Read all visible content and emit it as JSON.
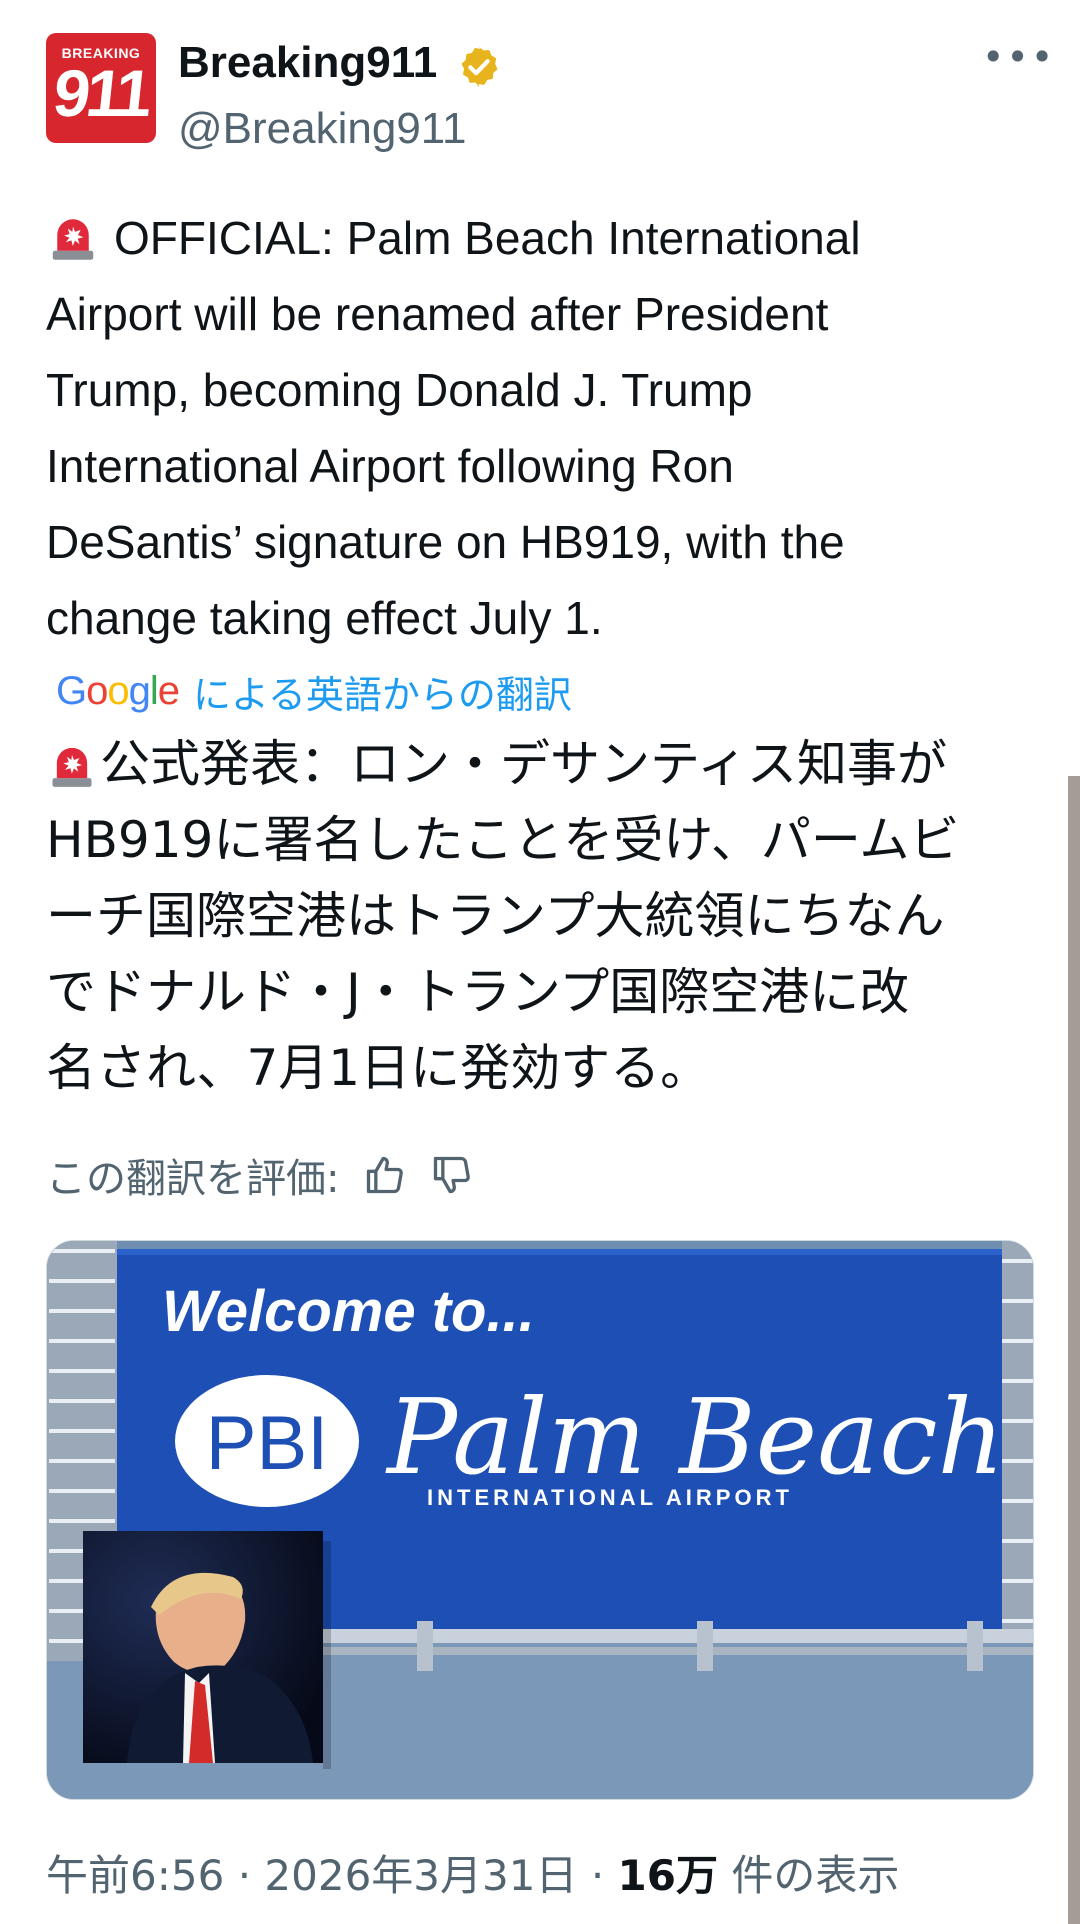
{
  "account": {
    "avatar_top_text": "BREAKING",
    "avatar_number": "911",
    "display_name": "Breaking911",
    "handle": "@Breaking911",
    "verified": true,
    "verified_badge_color": "#e8b41e"
  },
  "post": {
    "text_lines": [
      "OFFICIAL: Palm Beach International",
      "Airport will be renamed after President",
      "Trump, becoming Donald J. Trump",
      "International Airport following Ron",
      "DeSantis’ signature on HB919, with the",
      "change taking effect July 1."
    ],
    "emoji": "siren-icon",
    "translation": {
      "provider_logo": "Google",
      "label": "による英語からの翻訳",
      "text_lines": [
        "公式発表：ロン・デサンティス知事が",
        "HB919に署名したことを受け、パームビ",
        "ーチ国際空港はトランプ大統領にちなん",
        "でドナルド・J・トランプ国際空港に改",
        "名され、7月1日に発効する。"
      ],
      "rate_label": "この翻訳を評価:"
    },
    "media": {
      "sign_welcome": "Welcome to...",
      "sign_logo": "PBI",
      "sign_name": "Palm Beach",
      "sign_subtitle": "INTERNATIONAL AIRPORT"
    },
    "meta": {
      "time": "午前6:56",
      "separator": "·",
      "date": "2026年3月31日",
      "views_count": "16万",
      "views_label": " 件の表示"
    }
  },
  "colors": {
    "accent": "#1d9bf0",
    "text_primary": "#0f1419",
    "text_secondary": "#536471",
    "sign_blue": "#1d4fb4"
  }
}
